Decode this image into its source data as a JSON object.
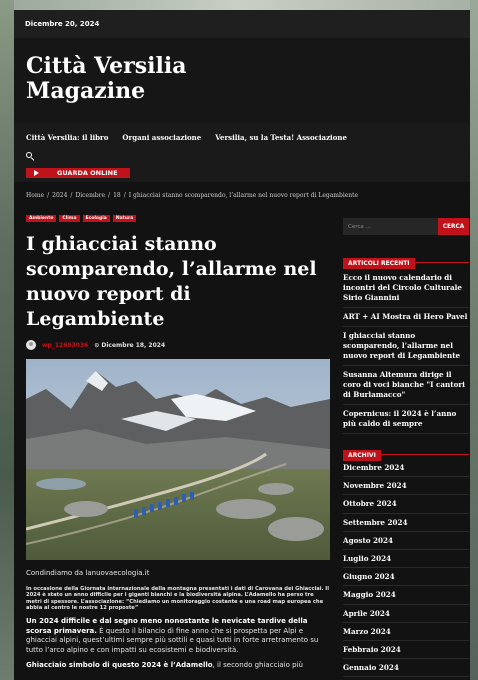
{
  "topbar": {
    "date": "Dicembre 20, 2024"
  },
  "site": {
    "title_line1": "Città Versilia",
    "title_line2": "Magazine"
  },
  "nav": {
    "links": [
      "Città Versilia: il libro",
      "Organi associazione",
      "Versilia, su la Testa! Associazione"
    ],
    "search_icon": "search-icon",
    "watch_label": "GUARDA ONLINE"
  },
  "breadcrumb": [
    "Home",
    "2024",
    "Dicembre",
    "18",
    "I ghiacciai stanno scomparendo, l’allarme nel nuovo report di Legambiente"
  ],
  "article": {
    "tags": [
      "Ambiente",
      "Clima",
      "Ecologia",
      "Natura"
    ],
    "title": "I ghiacciai stanno scomparendo, l’allarme nel nuovo report di Legambiente",
    "author": "wp_12693036",
    "date": "Dicembre 18, 2024",
    "caption": "Condindiamo da lanuovaecologia.it",
    "lead": "In occasione della Giornata internazionale della montagna presentati i dati di Carovana dei Ghiacciai. Il 2024 è stato un anno difficile per i giganti bianchi e la biodiversità alpina. L’Adamello ha perso tre metri di spessore. L’associazione: “Chiediamo un monitoraggio costante e una road map europea che abbia al centro le nostre 12 proposte”",
    "para1_bold": "Un 2024 difficile e dal segno meno nonostante le nevicate tardive della scorsa primavera.",
    "para1_rest": " È questo il bilancio di fine anno che si prospetta per Alpi e ghiacciai alpini, quest’ultimi sempre più sottili e quasi tutti in forte arretramento su tutto l’arco alpino e con impatti su ecosistemi e biodiversità.",
    "para2_bold": "Ghiacciaio simbolo di questo 2024 è l’Adamello",
    "para2_rest": ", il secondo ghiacciaio più"
  },
  "sidebar": {
    "search_placeholder": "Cerca ...",
    "search_button": "CERCA",
    "recent_title": "ARTICOLI RECENTI",
    "recent": [
      "Ecco il nuovo calendario di incontri del Circolo Culturale Sirio Giannini",
      "ART + AI Mostra di Hero Pavel",
      "I ghiacciai stanno scomparendo, l’allarme nel nuovo report di Legambiente",
      "Susanna Altemura dirige il coro di voci bianche \"I cantori di Burlamacco\"",
      "Copernicus: il 2024 è l’anno più caldo di sempre"
    ],
    "archive_title": "ARCHIVI",
    "archives": [
      "Dicembre 2024",
      "Novembre 2024",
      "Ottobre 2024",
      "Settembre 2024",
      "Agosto 2024",
      "Luglio 2024",
      "Giugno 2024",
      "Maggio 2024",
      "Aprile 2024",
      "Marzo 2024",
      "Febbraio 2024",
      "Gennaio 2024"
    ]
  },
  "colors": {
    "accent": "#c0121a",
    "background": "#121212",
    "text": "#ffffff"
  }
}
